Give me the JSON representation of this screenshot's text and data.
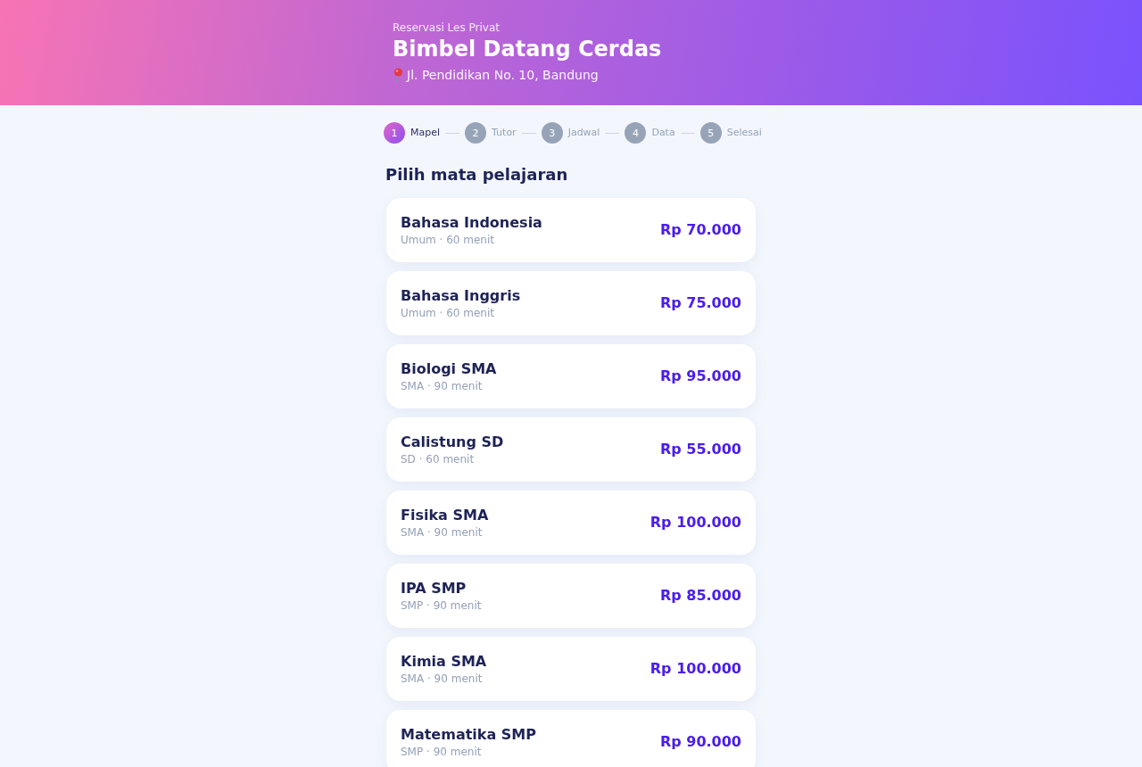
{
  "header": {
    "eyebrow": "Reservasi Les Privat",
    "title": "Bimbel Datang Cerdas",
    "address": "Jl. Pendidikan No. 10, Bandung"
  },
  "steps": [
    {
      "number": "1",
      "label": "Mapel",
      "selected": true
    },
    {
      "number": "2",
      "label": "Tutor",
      "selected": false
    },
    {
      "number": "3",
      "label": "Jadwal",
      "selected": false
    },
    {
      "number": "4",
      "label": "Data",
      "selected": false
    },
    {
      "number": "5",
      "label": "Selesai",
      "selected": false
    }
  ],
  "section_title": "Pilih mata pelajaran",
  "subjects": [
    {
      "name": "Bahasa Indonesia",
      "meta": "Umum · 60 menit",
      "price": "Rp 70.000"
    },
    {
      "name": "Bahasa Inggris",
      "meta": "Umum · 60 menit",
      "price": "Rp 75.000"
    },
    {
      "name": "Biologi SMA",
      "meta": "SMA · 90 menit",
      "price": "Rp 95.000"
    },
    {
      "name": "Calistung SD",
      "meta": "SD · 60 menit",
      "price": "Rp 55.000"
    },
    {
      "name": "Fisika SMA",
      "meta": "SMA · 90 menit",
      "price": "Rp 100.000"
    },
    {
      "name": "IPA SMP",
      "meta": "SMP · 90 menit",
      "price": "Rp 85.000"
    },
    {
      "name": "Kimia SMA",
      "meta": "SMA · 90 menit",
      "price": "Rp 100.000"
    },
    {
      "name": "Matematika SMP",
      "meta": "SMP · 90 menit",
      "price": "Rp 90.000"
    }
  ]
}
